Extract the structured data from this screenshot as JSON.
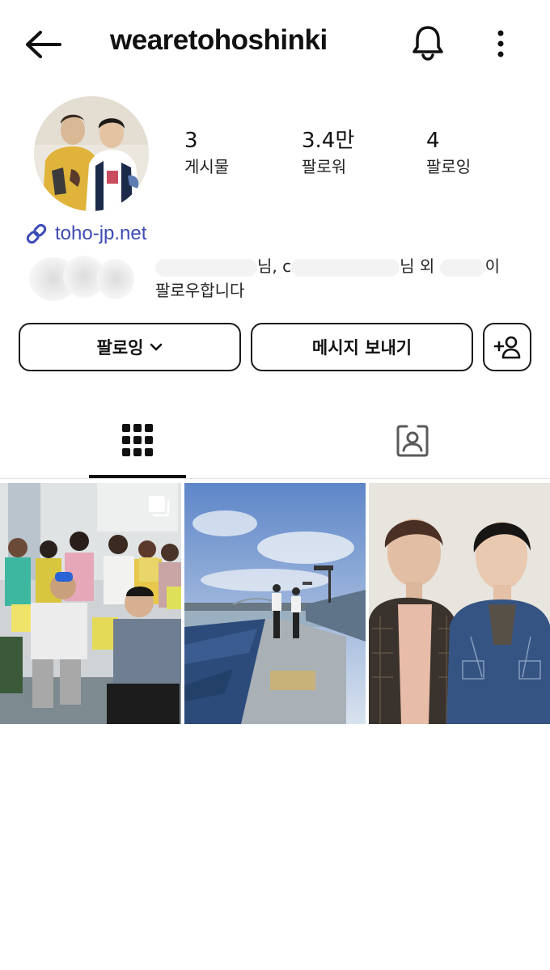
{
  "header": {
    "username": "weareto hoshinki",
    "back_icon": "arrow-left-icon",
    "bell_icon": "bell-icon",
    "more_icon": "more-vertical-icon"
  },
  "profile": {
    "stats": {
      "posts": {
        "value": "3",
        "label": "게시물"
      },
      "followers": {
        "value": "3.4만",
        "label": "팔로워"
      },
      "following": {
        "value": "4",
        "label": "팔로잉"
      }
    },
    "link": {
      "icon": "link-icon",
      "text": "toho-jp.net"
    },
    "followed_by": {
      "part1": "님, ",
      "part2": "c",
      "part3": "님 외 ",
      "part4": "이",
      "line2": "팔로우합니다"
    }
  },
  "actions": {
    "following_label": "팔로잉",
    "message_label": "메시지 보내기",
    "add_person_icon": "add-person-icon"
  },
  "tabs": [
    {
      "name": "grid",
      "icon": "grid-icon",
      "active": true
    },
    {
      "name": "tagged",
      "icon": "tagged-person-icon",
      "active": false
    }
  ],
  "posts": [
    {
      "description": "group photo",
      "multiple": true
    },
    {
      "description": "stadium stands",
      "multiple": false
    },
    {
      "description": "two men portrait",
      "multiple": false
    }
  ],
  "colors": {
    "link": "#3d4bb5",
    "text": "#111111",
    "divider": "#e4e4e4"
  }
}
